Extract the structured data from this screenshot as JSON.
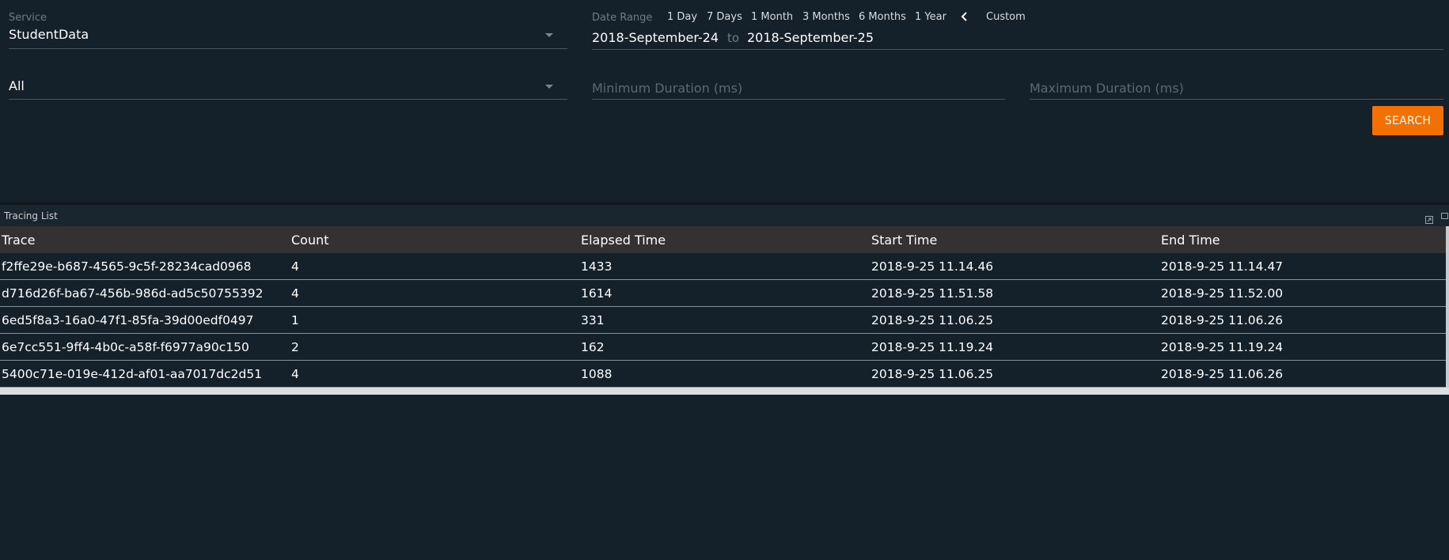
{
  "filters": {
    "service_label": "Service",
    "service_value": "StudentData",
    "endpoint_value": "All",
    "date_range_label": "Date Range",
    "range_options": [
      "1 Day",
      "7 Days",
      "1 Month",
      "3 Months",
      "6 Months",
      "1 Year"
    ],
    "custom_label": "Custom",
    "date_from": "2018-September-24",
    "date_to_separator": "to",
    "date_to": "2018-September-25",
    "min_duration_placeholder": "Minimum Duration (ms)",
    "max_duration_placeholder": "Maximum Duration (ms)",
    "search_label": "SEARCH"
  },
  "panel": {
    "title": "Tracing List"
  },
  "table": {
    "columns": [
      "Trace",
      "Count",
      "Elapsed Time",
      "Start Time",
      "End Time"
    ],
    "rows": [
      [
        "f2ffe29e-b687-4565-9c5f-28234cad0968",
        "4",
        "1433",
        "2018-9-25 11.14.46",
        "2018-9-25 11.14.47"
      ],
      [
        "d716d26f-ba67-456b-986d-ad5c50755392",
        "4",
        "1614",
        "2018-9-25 11.51.58",
        "2018-9-25 11.52.00"
      ],
      [
        "6ed5f8a3-16a0-47f1-85fa-39d00edf0497",
        "1",
        "331",
        "2018-9-25 11.06.25",
        "2018-9-25 11.06.26"
      ],
      [
        "6e7cc551-9ff4-4b0c-a58f-f6977a90c150",
        "2",
        "162",
        "2018-9-25 11.19.24",
        "2018-9-25 11.19.24"
      ],
      [
        "5400c71e-019e-412d-af01-aa7017dc2d51",
        "4",
        "1088",
        "2018-9-25 11.06.25",
        "2018-9-25 11.06.26"
      ]
    ]
  },
  "colors": {
    "background": "#14202a",
    "accent": "#f27004",
    "table_header": "#333131"
  },
  "icons": {
    "dropdown": "caret-down-icon",
    "back": "chevron-left-icon",
    "popout": "popout-icon",
    "maximize": "maximize-icon"
  }
}
